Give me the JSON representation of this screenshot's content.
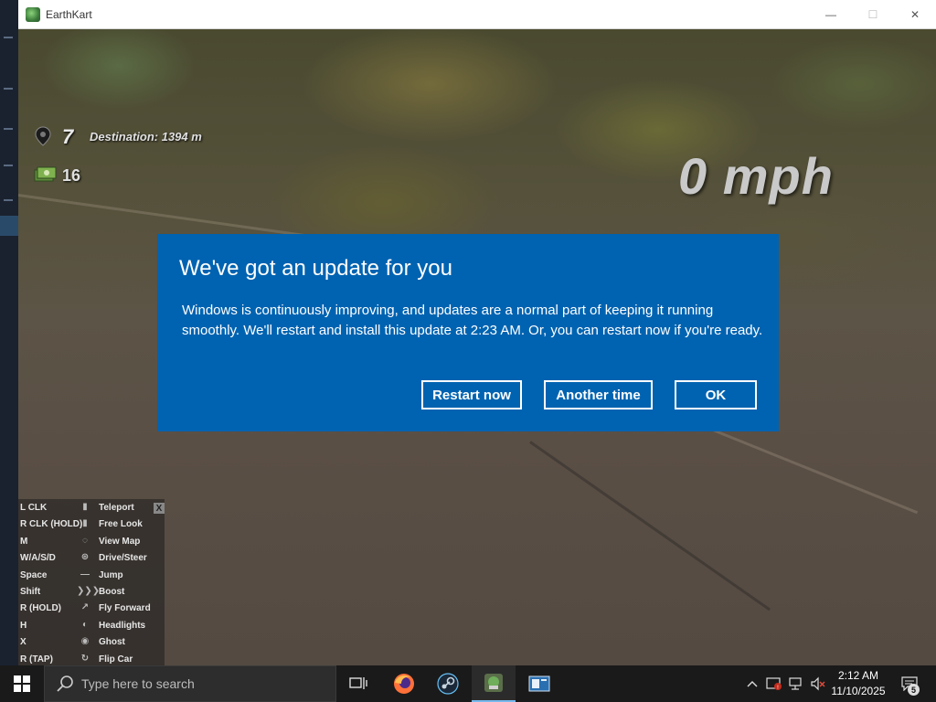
{
  "window": {
    "title": "EarthKart",
    "controls": {
      "minimize": "—",
      "maximize": "☐",
      "close": "✕"
    }
  },
  "hud": {
    "destinations_left": "7",
    "destination_label": "Destination: 1394 m",
    "cash": "16",
    "speed": "0 mph"
  },
  "help_panel": {
    "close_label": "X",
    "rows": [
      {
        "key": "L CLK",
        "action": "Teleport",
        "icon": "mouse-left-icon"
      },
      {
        "key": "R CLK (HOLD)",
        "action": "Free Look",
        "icon": "mouse-right-icon"
      },
      {
        "key": "M",
        "action": "View Map",
        "icon": "map-icon"
      },
      {
        "key": "W/A/S/D",
        "action": "Drive/Steer",
        "icon": "steering-icon"
      },
      {
        "key": "Space",
        "action": "Jump",
        "icon": "jump-icon"
      },
      {
        "key": "Shift",
        "action": "Boost",
        "icon": "boost-icon"
      },
      {
        "key": "R (HOLD)",
        "action": "Fly Forward",
        "icon": "fly-icon"
      },
      {
        "key": "H",
        "action": "Headlights",
        "icon": "headlights-icon"
      },
      {
        "key": "X",
        "action": "Ghost",
        "icon": "ghost-icon"
      },
      {
        "key": "R (TAP)",
        "action": "Flip Car",
        "icon": "flip-icon"
      }
    ]
  },
  "dialog": {
    "title": "We've got an update for you",
    "body": "Windows is continuously improving, and updates are a normal part of keeping it running smoothly. We'll restart and install this update at 2:23 AM. Or, you can restart now if you're ready.",
    "buttons": {
      "restart": "Restart now",
      "another": "Another time",
      "ok": "OK"
    }
  },
  "taskbar": {
    "search_placeholder": "Type here to search",
    "time": "2:12 AM",
    "date": "11/10/2025",
    "notification_count": "5"
  }
}
